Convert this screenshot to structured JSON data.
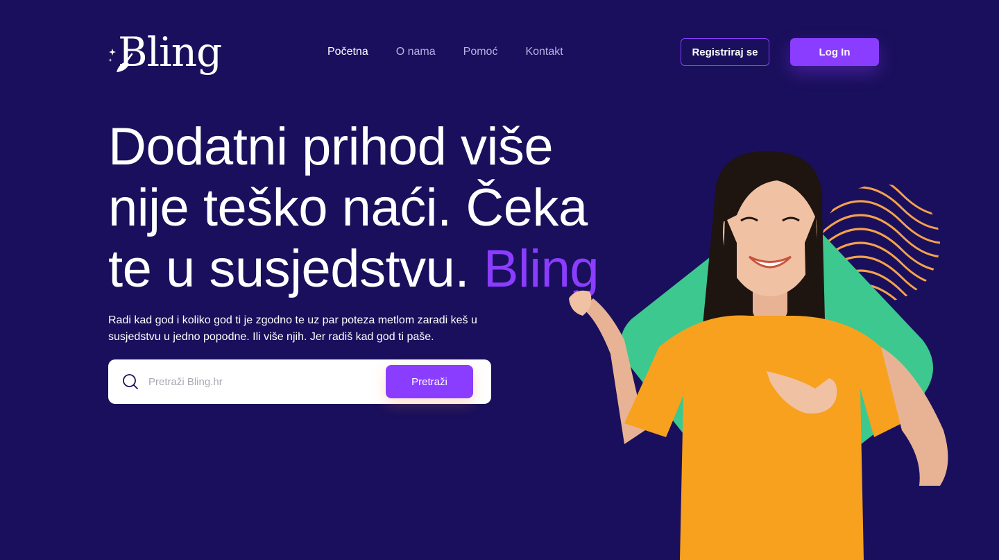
{
  "brand": {
    "logo_text": "Bling",
    "logo_icon": "broom-sparkle-icon",
    "accent_color": "#8b3dff",
    "background_color": "#1a0f5c"
  },
  "nav": {
    "items": [
      {
        "label": "Početna",
        "active": true
      },
      {
        "label": "O nama",
        "active": false
      },
      {
        "label": "Pomoć",
        "active": false
      },
      {
        "label": "Kontakt",
        "active": false
      }
    ]
  },
  "header": {
    "register_label": "Registriraj se",
    "login_label": "Log In"
  },
  "hero": {
    "headline_main": "Dodatni prihod više nije teško naći. Čeka te u susjedstvu. ",
    "headline_accent": "Bling",
    "subtext": "Radi kad god i koliko god ti je zgodno te uz par poteza metlom zaradi keš u susjedstvu u jedno popodne. Ili više njih. Jer radiš kad god ti paše."
  },
  "search": {
    "placeholder": "Pretraži Bling.hr",
    "value": "",
    "button_label": "Pretraži",
    "icon": "search-icon"
  },
  "visual": {
    "shape_color": "#3cc88f",
    "stripes_color": "#f5a24a",
    "shirt_color": "#f7a11f"
  }
}
